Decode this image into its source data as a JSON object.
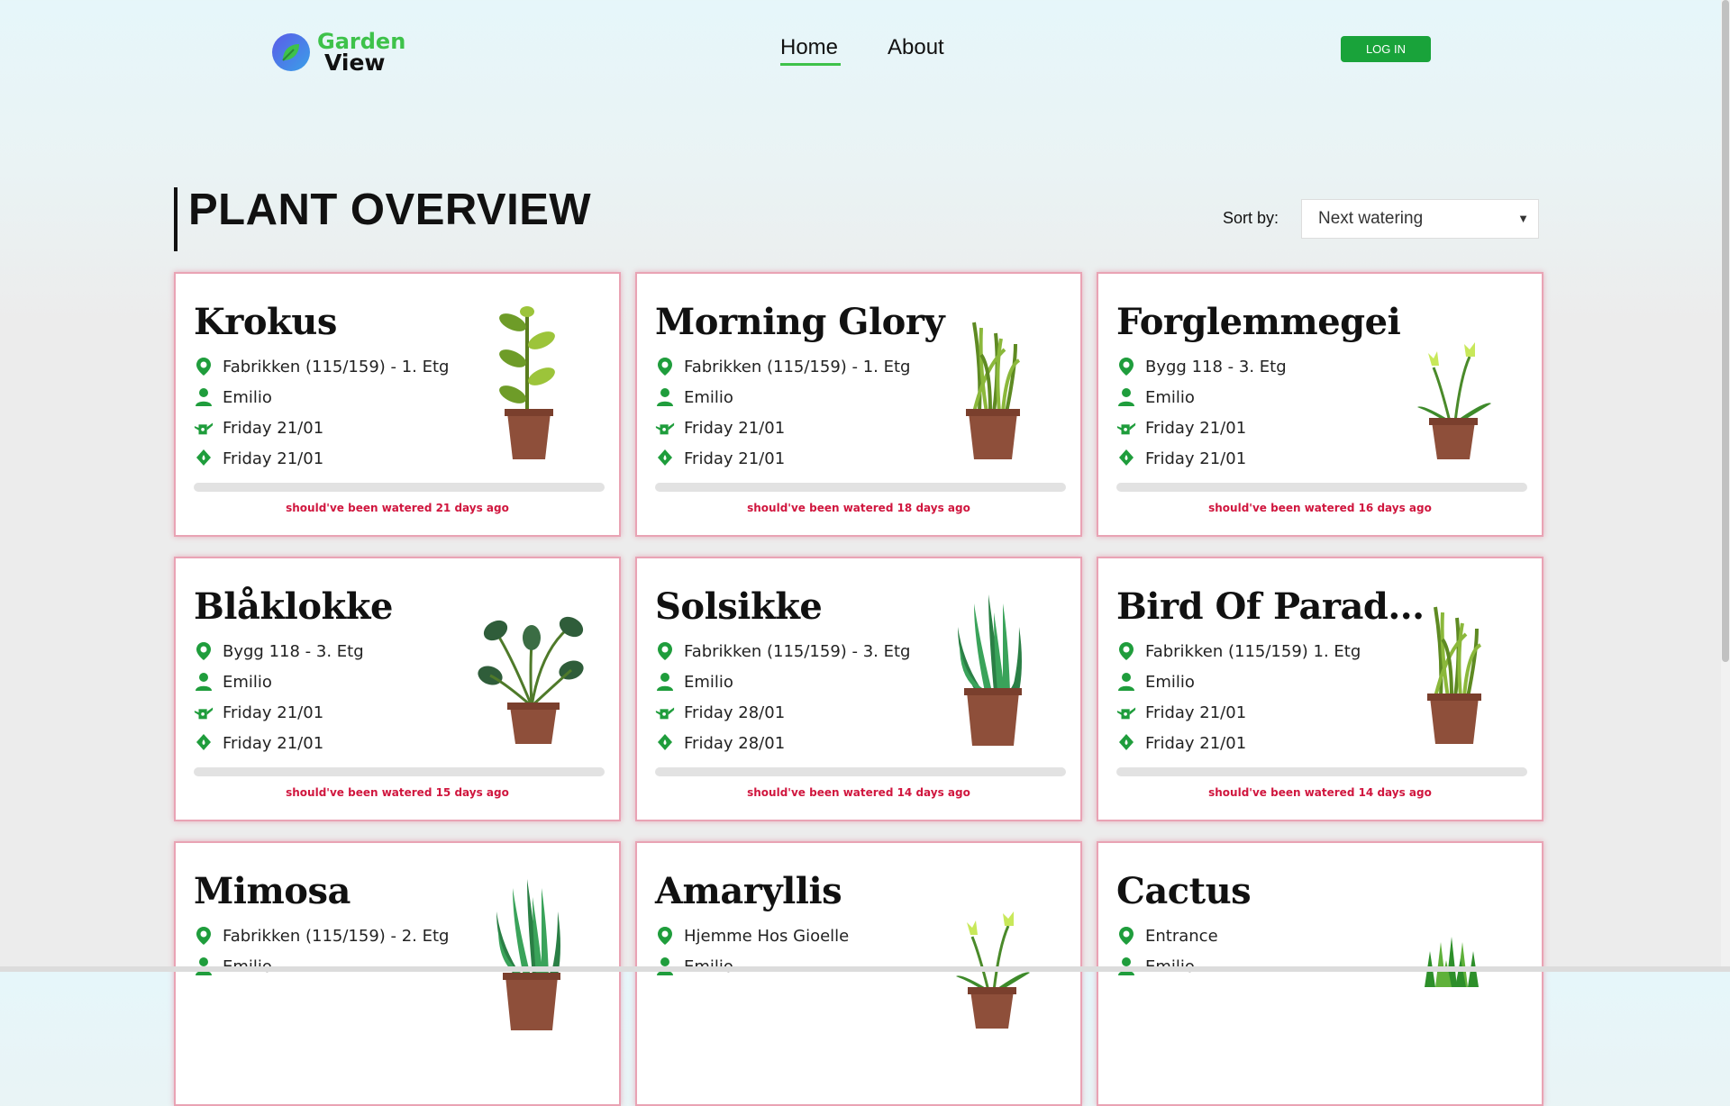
{
  "header": {
    "logo_line1": "Garden",
    "logo_line2": "View",
    "nav": {
      "home": "Home",
      "about": "About"
    },
    "login": "LOG IN"
  },
  "main": {
    "title": "PLANT OVERVIEW",
    "sort_label": "Sort by:",
    "sort_value": "Next watering"
  },
  "colors": {
    "accent": "#3ec24a",
    "login": "#19a33a",
    "alert": "#d0163e",
    "icon": "#1f9d3c"
  },
  "cards": [
    {
      "name": "Krokus",
      "location": "Fabrikken (115/159) - 1. Etg",
      "person": "Emilio",
      "last_watered": "Friday 21/01",
      "next_watered": "Friday 21/01",
      "status": "should've been watered 21 days ago",
      "plant": "leafy"
    },
    {
      "name": "Morning Glory",
      "location": "Fabrikken (115/159) - 1. Etg",
      "person": "Emilio",
      "last_watered": "Friday 21/01",
      "next_watered": "Friday 21/01",
      "status": "should've been watered 18 days ago",
      "plant": "grass"
    },
    {
      "name": "Forglemmegei",
      "location": "Bygg 118 - 3. Etg",
      "person": "Emilio",
      "last_watered": "Friday 21/01",
      "next_watered": "Friday 21/01",
      "status": "should've been watered 16 days ago",
      "plant": "tulip"
    },
    {
      "name": "Blåklokke",
      "location": "Bygg 118 - 3. Etg",
      "person": "Emilio",
      "last_watered": "Friday 21/01",
      "next_watered": "Friday 21/01",
      "status": "should've been watered 15 days ago",
      "plant": "broadleaf"
    },
    {
      "name": "Solsikke",
      "location": "Fabrikken (115/159) - 3. Etg",
      "person": "Emilio",
      "last_watered": "Friday 28/01",
      "next_watered": "Friday 28/01",
      "status": "should've been watered 14 days ago",
      "plant": "aloe"
    },
    {
      "name": "Bird Of Parad...",
      "location": "Fabrikken (115/159) 1. Etg",
      "person": "Emilio",
      "last_watered": "Friday 21/01",
      "next_watered": "Friday 21/01",
      "status": "should've been watered 14 days ago",
      "plant": "grass"
    },
    {
      "name": "Mimosa",
      "location": "Fabrikken (115/159) - 2. Etg",
      "person": "Emilio",
      "last_watered": "",
      "next_watered": "",
      "status": "",
      "plant": "aloe"
    },
    {
      "name": "Amaryllis",
      "location": "Hjemme Hos Gioelle",
      "person": "Emilio",
      "last_watered": "",
      "next_watered": "",
      "status": "",
      "plant": "tulip"
    },
    {
      "name": "Cactus",
      "location": "Entrance",
      "person": "Emilio",
      "last_watered": "",
      "next_watered": "",
      "status": "",
      "plant": "cactus"
    }
  ]
}
